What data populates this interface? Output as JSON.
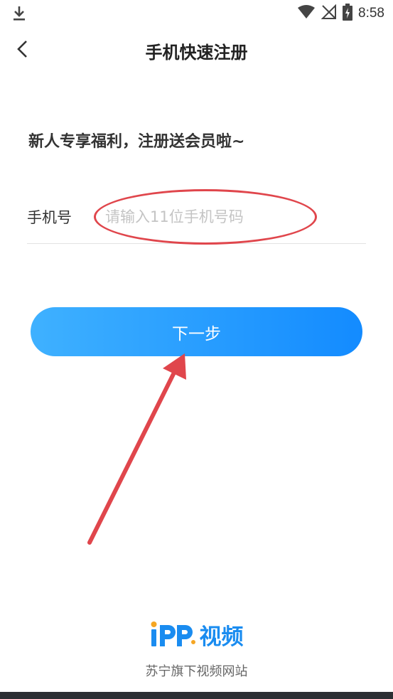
{
  "status_bar": {
    "time": "8:58",
    "icons": [
      "download-icon",
      "wifi-icon",
      "signal-off-icon",
      "battery-charging-icon"
    ]
  },
  "header": {
    "title": "手机快速注册",
    "back_icon": "chevron-left-icon"
  },
  "promo_text": "新人专享福利，注册送会员啦~",
  "phone_field": {
    "label": "手机号",
    "placeholder": "请输入11位手机号码",
    "value": ""
  },
  "next_button_label": "下一步",
  "brand": {
    "logo_text": "PP",
    "name": "视频",
    "tagline": "苏宁旗下视频网站"
  },
  "colors": {
    "accent": "#138bff",
    "accent_light": "#3fb1ff",
    "annotation": "#e0464c",
    "brand": "#1a8cf0"
  }
}
